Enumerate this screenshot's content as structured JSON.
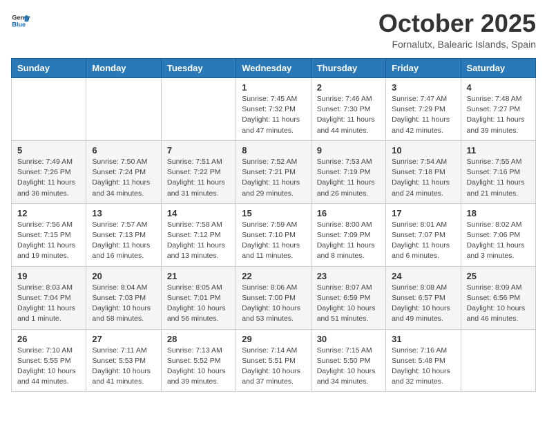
{
  "logo": {
    "general": "General",
    "blue": "Blue"
  },
  "header": {
    "month": "October 2025",
    "location": "Fornalutx, Balearic Islands, Spain"
  },
  "weekdays": [
    "Sunday",
    "Monday",
    "Tuesday",
    "Wednesday",
    "Thursday",
    "Friday",
    "Saturday"
  ],
  "weeks": [
    [
      {
        "day": "",
        "info": ""
      },
      {
        "day": "",
        "info": ""
      },
      {
        "day": "",
        "info": ""
      },
      {
        "day": "1",
        "info": "Sunrise: 7:45 AM\nSunset: 7:32 PM\nDaylight: 11 hours and 47 minutes."
      },
      {
        "day": "2",
        "info": "Sunrise: 7:46 AM\nSunset: 7:30 PM\nDaylight: 11 hours and 44 minutes."
      },
      {
        "day": "3",
        "info": "Sunrise: 7:47 AM\nSunset: 7:29 PM\nDaylight: 11 hours and 42 minutes."
      },
      {
        "day": "4",
        "info": "Sunrise: 7:48 AM\nSunset: 7:27 PM\nDaylight: 11 hours and 39 minutes."
      }
    ],
    [
      {
        "day": "5",
        "info": "Sunrise: 7:49 AM\nSunset: 7:26 PM\nDaylight: 11 hours and 36 minutes."
      },
      {
        "day": "6",
        "info": "Sunrise: 7:50 AM\nSunset: 7:24 PM\nDaylight: 11 hours and 34 minutes."
      },
      {
        "day": "7",
        "info": "Sunrise: 7:51 AM\nSunset: 7:22 PM\nDaylight: 11 hours and 31 minutes."
      },
      {
        "day": "8",
        "info": "Sunrise: 7:52 AM\nSunset: 7:21 PM\nDaylight: 11 hours and 29 minutes."
      },
      {
        "day": "9",
        "info": "Sunrise: 7:53 AM\nSunset: 7:19 PM\nDaylight: 11 hours and 26 minutes."
      },
      {
        "day": "10",
        "info": "Sunrise: 7:54 AM\nSunset: 7:18 PM\nDaylight: 11 hours and 24 minutes."
      },
      {
        "day": "11",
        "info": "Sunrise: 7:55 AM\nSunset: 7:16 PM\nDaylight: 11 hours and 21 minutes."
      }
    ],
    [
      {
        "day": "12",
        "info": "Sunrise: 7:56 AM\nSunset: 7:15 PM\nDaylight: 11 hours and 19 minutes."
      },
      {
        "day": "13",
        "info": "Sunrise: 7:57 AM\nSunset: 7:13 PM\nDaylight: 11 hours and 16 minutes."
      },
      {
        "day": "14",
        "info": "Sunrise: 7:58 AM\nSunset: 7:12 PM\nDaylight: 11 hours and 13 minutes."
      },
      {
        "day": "15",
        "info": "Sunrise: 7:59 AM\nSunset: 7:10 PM\nDaylight: 11 hours and 11 minutes."
      },
      {
        "day": "16",
        "info": "Sunrise: 8:00 AM\nSunset: 7:09 PM\nDaylight: 11 hours and 8 minutes."
      },
      {
        "day": "17",
        "info": "Sunrise: 8:01 AM\nSunset: 7:07 PM\nDaylight: 11 hours and 6 minutes."
      },
      {
        "day": "18",
        "info": "Sunrise: 8:02 AM\nSunset: 7:06 PM\nDaylight: 11 hours and 3 minutes."
      }
    ],
    [
      {
        "day": "19",
        "info": "Sunrise: 8:03 AM\nSunset: 7:04 PM\nDaylight: 11 hours and 1 minute."
      },
      {
        "day": "20",
        "info": "Sunrise: 8:04 AM\nSunset: 7:03 PM\nDaylight: 10 hours and 58 minutes."
      },
      {
        "day": "21",
        "info": "Sunrise: 8:05 AM\nSunset: 7:01 PM\nDaylight: 10 hours and 56 minutes."
      },
      {
        "day": "22",
        "info": "Sunrise: 8:06 AM\nSunset: 7:00 PM\nDaylight: 10 hours and 53 minutes."
      },
      {
        "day": "23",
        "info": "Sunrise: 8:07 AM\nSunset: 6:59 PM\nDaylight: 10 hours and 51 minutes."
      },
      {
        "day": "24",
        "info": "Sunrise: 8:08 AM\nSunset: 6:57 PM\nDaylight: 10 hours and 49 minutes."
      },
      {
        "day": "25",
        "info": "Sunrise: 8:09 AM\nSunset: 6:56 PM\nDaylight: 10 hours and 46 minutes."
      }
    ],
    [
      {
        "day": "26",
        "info": "Sunrise: 7:10 AM\nSunset: 5:55 PM\nDaylight: 10 hours and 44 minutes."
      },
      {
        "day": "27",
        "info": "Sunrise: 7:11 AM\nSunset: 5:53 PM\nDaylight: 10 hours and 41 minutes."
      },
      {
        "day": "28",
        "info": "Sunrise: 7:13 AM\nSunset: 5:52 PM\nDaylight: 10 hours and 39 minutes."
      },
      {
        "day": "29",
        "info": "Sunrise: 7:14 AM\nSunset: 5:51 PM\nDaylight: 10 hours and 37 minutes."
      },
      {
        "day": "30",
        "info": "Sunrise: 7:15 AM\nSunset: 5:50 PM\nDaylight: 10 hours and 34 minutes."
      },
      {
        "day": "31",
        "info": "Sunrise: 7:16 AM\nSunset: 5:48 PM\nDaylight: 10 hours and 32 minutes."
      },
      {
        "day": "",
        "info": ""
      }
    ]
  ]
}
